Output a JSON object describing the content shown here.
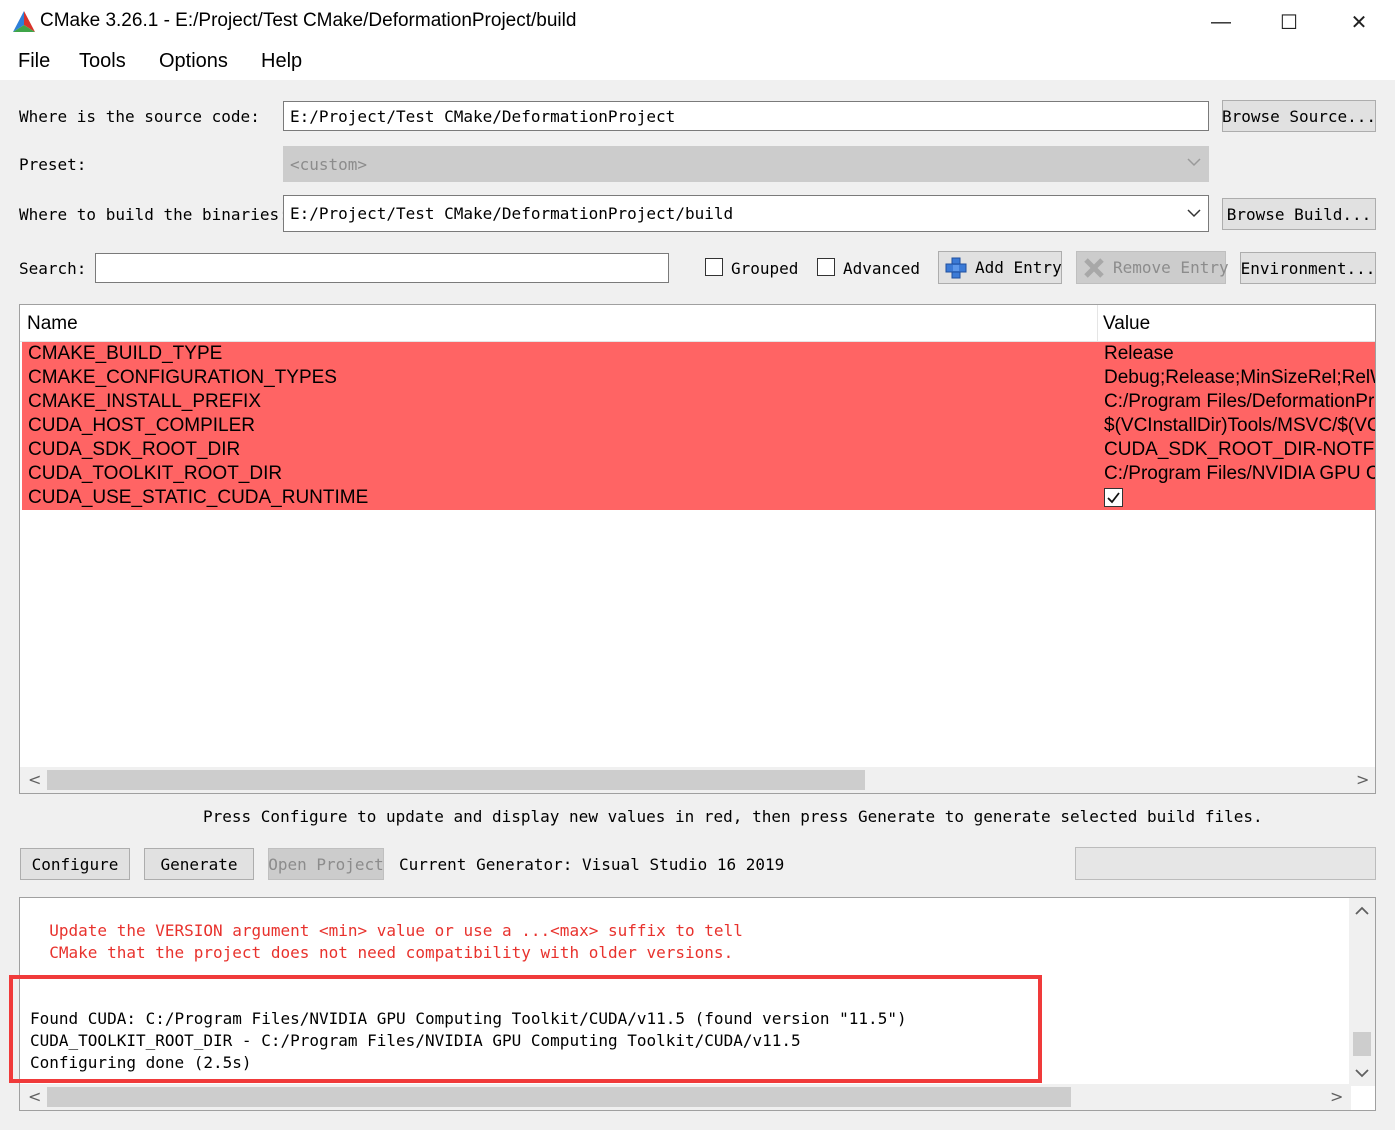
{
  "window": {
    "title": "CMake 3.26.1 - E:/Project/Test CMake/DeformationProject/build",
    "minimize": "—",
    "maximize": "☐",
    "close": "✕"
  },
  "menu": [
    "File",
    "Tools",
    "Options",
    "Help"
  ],
  "source": {
    "label": "Where is the source code:",
    "value": "E:/Project/Test CMake/DeformationProject",
    "browse_label": "Browse Source..."
  },
  "preset": {
    "label": "Preset:",
    "value": "<custom>"
  },
  "build": {
    "label": "Where to build the binaries:",
    "value": "E:/Project/Test CMake/DeformationProject/build",
    "browse_label": "Browse Build..."
  },
  "search": {
    "label": "Search:",
    "value": ""
  },
  "options": {
    "grouped_label": "Grouped",
    "grouped_checked": false,
    "advanced_label": "Advanced",
    "advanced_checked": false,
    "add_entry_label": "Add Entry",
    "remove_entry_label": "Remove Entry",
    "environment_label": "Environment..."
  },
  "table": {
    "headers": [
      "Name",
      "Value"
    ],
    "row_color": "#ff6464",
    "rows": [
      {
        "name": "CMAKE_BUILD_TYPE",
        "value": "Release"
      },
      {
        "name": "CMAKE_CONFIGURATION_TYPES",
        "value": "Debug;Release;MinSizeRel;RelW"
      },
      {
        "name": "CMAKE_INSTALL_PREFIX",
        "value": "C:/Program Files/DeformationPr"
      },
      {
        "name": "CUDA_HOST_COMPILER",
        "value": "$(VCInstallDir)Tools/MSVC/$(VC"
      },
      {
        "name": "CUDA_SDK_ROOT_DIR",
        "value": "CUDA_SDK_ROOT_DIR-NOTFOU"
      },
      {
        "name": "CUDA_TOOLKIT_ROOT_DIR",
        "value": "C:/Program Files/NVIDIA GPU C"
      },
      {
        "name": "CUDA_USE_STATIC_CUDA_RUNTIME",
        "value": "",
        "checkbox": true,
        "checked": true
      }
    ]
  },
  "hint": "Press Configure to update and display new values in red, then press Generate to generate selected build files.",
  "actions": {
    "configure_label": "Configure",
    "generate_label": "Generate",
    "open_project_label": "Open Project",
    "generator_text": "Current Generator: Visual Studio 16 2019"
  },
  "output": {
    "warning_color": "#e8322d",
    "warning_lines": [
      "  Update the VERSION argument <min> value or use a ...<max> suffix to tell",
      "  CMake that the project does not need compatibility with older versions."
    ],
    "lines": [
      "Found CUDA: C:/Program Files/NVIDIA GPU Computing Toolkit/CUDA/v11.5 (found version \"11.5\")",
      "CUDA_TOOLKIT_ROOT_DIR - C:/Program Files/NVIDIA GPU Computing Toolkit/CUDA/v11.5",
      "Configuring done (2.5s)"
    ],
    "highlight_color": "#f03a3a"
  }
}
